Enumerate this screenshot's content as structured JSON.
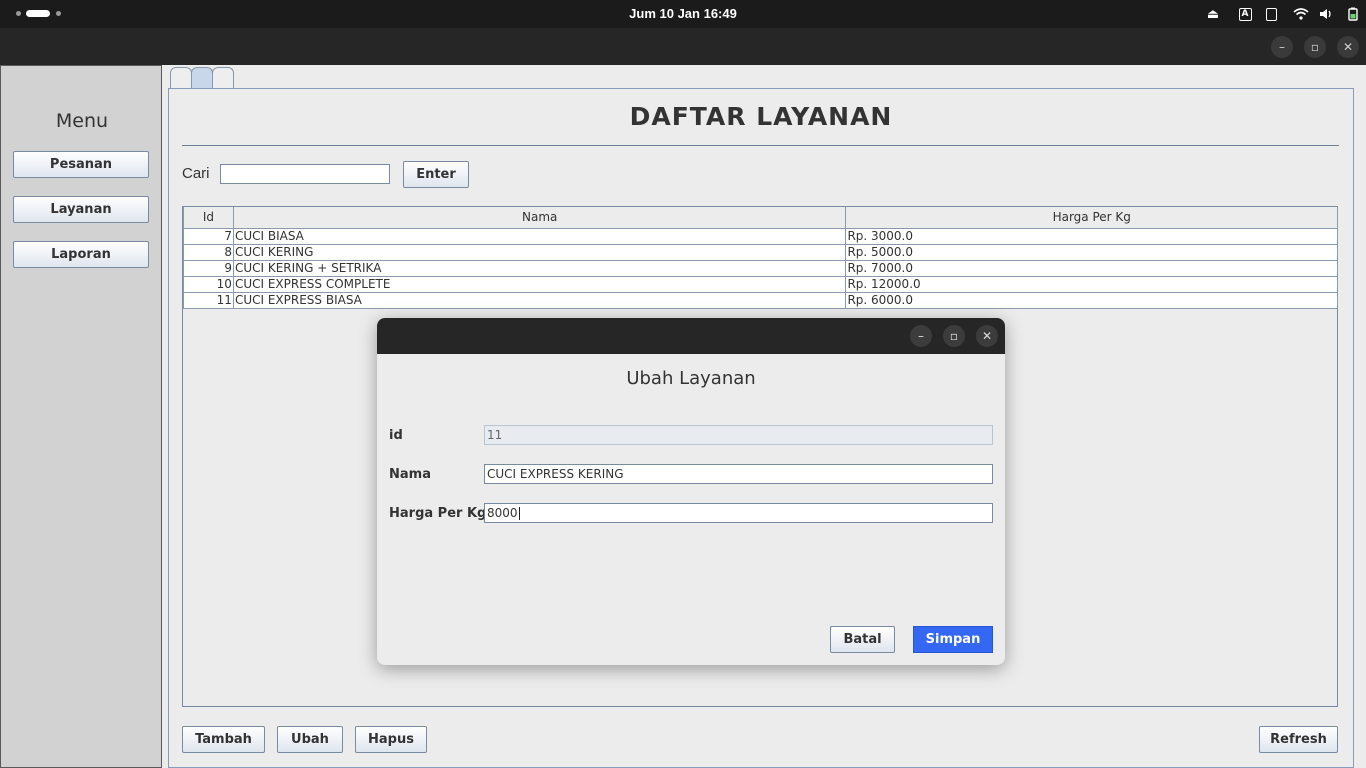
{
  "system_bar": {
    "clock": "Jum 10 Jan  16:49"
  },
  "window_controls": {
    "minimize": "–",
    "maximize": "▫",
    "close": "✕"
  },
  "menu": {
    "title": "Menu",
    "items": [
      "Pesanan",
      "Layanan",
      "Laporan"
    ]
  },
  "main": {
    "page_title": "DAFTAR LAYANAN",
    "search": {
      "label": "Cari",
      "value": "",
      "button": "Enter"
    },
    "table": {
      "columns": [
        "Id",
        "Nama",
        "Harga Per Kg"
      ],
      "rows": [
        [
          "7",
          "CUCI BIASA",
          "Rp. 3000.0"
        ],
        [
          "8",
          "CUCI KERING",
          "Rp. 5000.0"
        ],
        [
          "9",
          "CUCI KERING + SETRIKA",
          "Rp. 7000.0"
        ],
        [
          "10",
          "CUCI EXPRESS COMPLETE",
          "Rp. 12000.0"
        ],
        [
          "11",
          "CUCI EXPRESS BIASA",
          "Rp. 6000.0"
        ]
      ]
    },
    "actions": [
      "Tambah",
      "Ubah",
      "Hapus"
    ],
    "refresh": "Refresh"
  },
  "dialog": {
    "heading": "Ubah Layanan",
    "fields": [
      {
        "label": "id",
        "value": "11"
      },
      {
        "label": "Nama",
        "value": "CUCI EXPRESS KERING"
      },
      {
        "label": "Harga Per Kg",
        "value": "8000"
      }
    ],
    "cancel": "Batal",
    "save": "Simpan"
  }
}
